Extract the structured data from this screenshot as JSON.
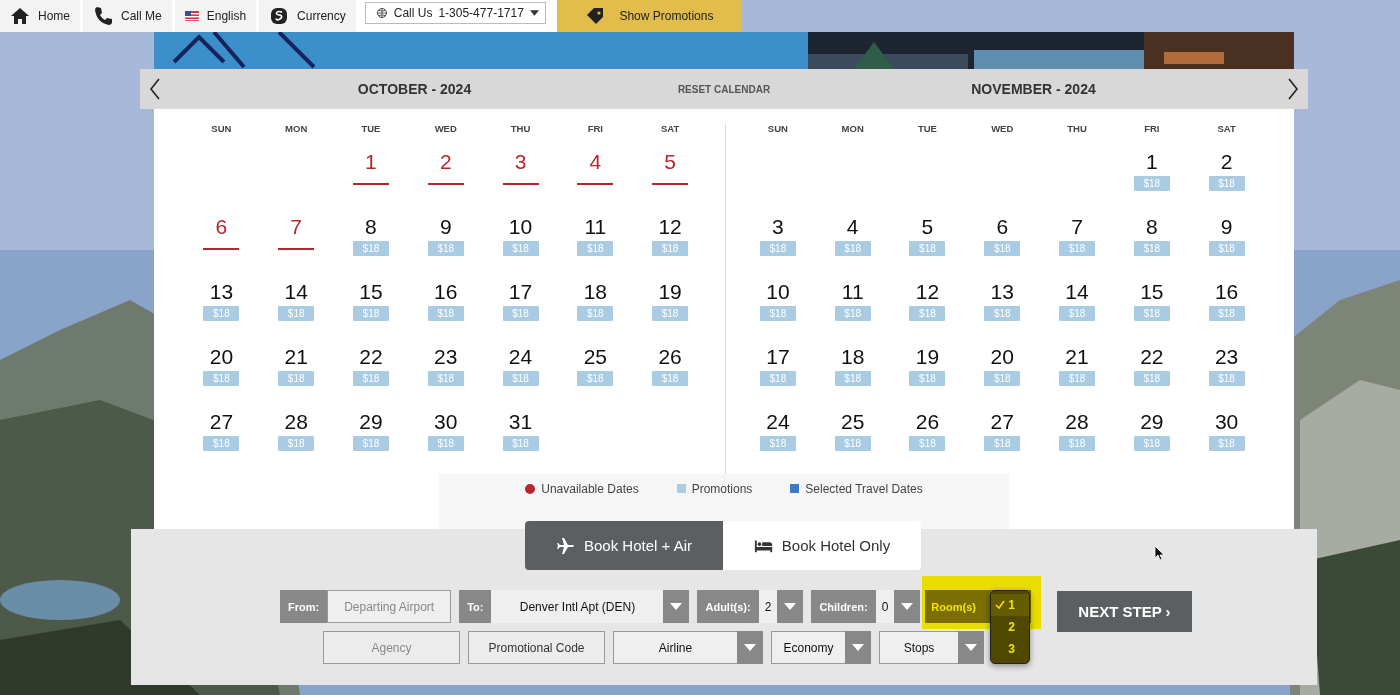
{
  "top_nav": [
    {
      "kind": "link",
      "label": "Home"
    },
    {
      "kind": "link",
      "label": "Call Me"
    },
    {
      "kind": "link",
      "label": "English"
    },
    {
      "kind": "link",
      "label": "Currency"
    },
    {
      "kind": "dropdown",
      "label": "Call Us",
      "number": "1-305-477-1717"
    },
    {
      "kind": "promo",
      "label": "Show Promotions"
    }
  ],
  "calendar": {
    "reset": "RESET CALENDAR",
    "months": [
      {
        "title": "OCTOBER - 2024",
        "weekdays": [
          "SUN",
          "MON",
          "TUE",
          "WED",
          "THU",
          "FRI",
          "SAT"
        ],
        "weeks": [
          [
            {
              "kind": "blank"
            },
            {
              "kind": "blank"
            },
            {
              "kind": "day",
              "day": "1",
              "unavailable": true
            },
            {
              "kind": "day",
              "day": "2",
              "unavailable": true
            },
            {
              "kind": "day",
              "day": "3",
              "unavailable": true
            },
            {
              "kind": "day",
              "day": "4",
              "unavailable": true
            },
            {
              "kind": "day",
              "day": "5",
              "unavailable": true
            }
          ],
          [
            {
              "kind": "day",
              "day": "6",
              "unavailable": true
            },
            {
              "kind": "day",
              "day": "7",
              "unavailable": true
            },
            {
              "kind": "day",
              "day": "8",
              "unavailable": false,
              "price": "$18"
            },
            {
              "kind": "day",
              "day": "9",
              "unavailable": false,
              "price": "$18"
            },
            {
              "kind": "day",
              "day": "10",
              "unavailable": false,
              "price": "$18"
            },
            {
              "kind": "day",
              "day": "11",
              "unavailable": false,
              "price": "$18"
            },
            {
              "kind": "day",
              "day": "12",
              "unavailable": false,
              "price": "$18"
            }
          ],
          [
            {
              "kind": "day",
              "day": "13",
              "unavailable": false,
              "price": "$18"
            },
            {
              "kind": "day",
              "day": "14",
              "unavailable": false,
              "price": "$18"
            },
            {
              "kind": "day",
              "day": "15",
              "unavailable": false,
              "price": "$18"
            },
            {
              "kind": "day",
              "day": "16",
              "unavailable": false,
              "price": "$18"
            },
            {
              "kind": "day",
              "day": "17",
              "unavailable": false,
              "price": "$18"
            },
            {
              "kind": "day",
              "day": "18",
              "unavailable": false,
              "price": "$18"
            },
            {
              "kind": "day",
              "day": "19",
              "unavailable": false,
              "price": "$18"
            }
          ],
          [
            {
              "kind": "day",
              "day": "20",
              "unavailable": false,
              "price": "$18"
            },
            {
              "kind": "day",
              "day": "21",
              "unavailable": false,
              "price": "$18"
            },
            {
              "kind": "day",
              "day": "22",
              "unavailable": false,
              "price": "$18"
            },
            {
              "kind": "day",
              "day": "23",
              "unavailable": false,
              "price": "$18"
            },
            {
              "kind": "day",
              "day": "24",
              "unavailable": false,
              "price": "$18"
            },
            {
              "kind": "day",
              "day": "25",
              "unavailable": false,
              "price": "$18"
            },
            {
              "kind": "day",
              "day": "26",
              "unavailable": false,
              "price": "$18"
            }
          ],
          [
            {
              "kind": "day",
              "day": "27",
              "unavailable": false,
              "price": "$18"
            },
            {
              "kind": "day",
              "day": "28",
              "unavailable": false,
              "price": "$18"
            },
            {
              "kind": "day",
              "day": "29",
              "unavailable": false,
              "price": "$18"
            },
            {
              "kind": "day",
              "day": "30",
              "unavailable": false,
              "price": "$18"
            },
            {
              "kind": "day",
              "day": "31",
              "unavailable": false,
              "price": "$18"
            },
            {
              "kind": "blank"
            },
            {
              "kind": "blank"
            }
          ]
        ]
      },
      {
        "title": "NOVEMBER - 2024",
        "weekdays": [
          "SUN",
          "MON",
          "TUE",
          "WED",
          "THU",
          "FRI",
          "SAT"
        ],
        "weeks": [
          [
            {
              "kind": "blank"
            },
            {
              "kind": "blank"
            },
            {
              "kind": "blank"
            },
            {
              "kind": "blank"
            },
            {
              "kind": "blank"
            },
            {
              "kind": "day",
              "day": "1",
              "unavailable": false,
              "price": "$18"
            },
            {
              "kind": "day",
              "day": "2",
              "unavailable": false,
              "price": "$18"
            }
          ],
          [
            {
              "kind": "day",
              "day": "3",
              "unavailable": false,
              "price": "$18"
            },
            {
              "kind": "day",
              "day": "4",
              "unavailable": false,
              "price": "$18"
            },
            {
              "kind": "day",
              "day": "5",
              "unavailable": false,
              "price": "$18"
            },
            {
              "kind": "day",
              "day": "6",
              "unavailable": false,
              "price": "$18"
            },
            {
              "kind": "day",
              "day": "7",
              "unavailable": false,
              "price": "$18"
            },
            {
              "kind": "day",
              "day": "8",
              "unavailable": false,
              "price": "$18"
            },
            {
              "kind": "day",
              "day": "9",
              "unavailable": false,
              "price": "$18"
            }
          ],
          [
            {
              "kind": "day",
              "day": "10",
              "unavailable": false,
              "price": "$18"
            },
            {
              "kind": "day",
              "day": "11",
              "unavailable": false,
              "price": "$18"
            },
            {
              "kind": "day",
              "day": "12",
              "unavailable": false,
              "price": "$18"
            },
            {
              "kind": "day",
              "day": "13",
              "unavailable": false,
              "price": "$18"
            },
            {
              "kind": "day",
              "day": "14",
              "unavailable": false,
              "price": "$18"
            },
            {
              "kind": "day",
              "day": "15",
              "unavailable": false,
              "price": "$18"
            },
            {
              "kind": "day",
              "day": "16",
              "unavailable": false,
              "price": "$18"
            }
          ],
          [
            {
              "kind": "day",
              "day": "17",
              "unavailable": false,
              "price": "$18"
            },
            {
              "kind": "day",
              "day": "18",
              "unavailable": false,
              "price": "$18"
            },
            {
              "kind": "day",
              "day": "19",
              "unavailable": false,
              "price": "$18"
            },
            {
              "kind": "day",
              "day": "20",
              "unavailable": false,
              "price": "$18"
            },
            {
              "kind": "day",
              "day": "21",
              "unavailable": false,
              "price": "$18"
            },
            {
              "kind": "day",
              "day": "22",
              "unavailable": false,
              "price": "$18"
            },
            {
              "kind": "day",
              "day": "23",
              "unavailable": false,
              "price": "$18"
            }
          ],
          [
            {
              "kind": "day",
              "day": "24",
              "unavailable": false,
              "price": "$18"
            },
            {
              "kind": "day",
              "day": "25",
              "unavailable": false,
              "price": "$18"
            },
            {
              "kind": "day",
              "day": "26",
              "unavailable": false,
              "price": "$18"
            },
            {
              "kind": "day",
              "day": "27",
              "unavailable": false,
              "price": "$18"
            },
            {
              "kind": "day",
              "day": "28",
              "unavailable": false,
              "price": "$18"
            },
            {
              "kind": "day",
              "day": "29",
              "unavailable": false,
              "price": "$18"
            },
            {
              "kind": "day",
              "day": "30",
              "unavailable": false,
              "price": "$18"
            }
          ]
        ]
      }
    ],
    "legend": [
      {
        "kind": "dot",
        "color": "#b5272d",
        "label": "Unavailable Dates"
      },
      {
        "kind": "square",
        "color": "#a9cce3",
        "label": "Promotions"
      },
      {
        "kind": "square",
        "color": "#3f79c4",
        "label": "Selected Travel Dates"
      }
    ]
  },
  "booking": {
    "modes": [
      {
        "label": "Book Hotel + Air",
        "selected": true
      },
      {
        "label": "Book Hotel Only",
        "selected": false
      }
    ],
    "row_1": [
      {
        "kind": "labeled-input",
        "label": "From:",
        "placeholder": "Departing Airport"
      },
      {
        "kind": "labeled-select",
        "label": "To:",
        "value": "Denver Intl Apt (DEN)"
      },
      {
        "kind": "labeled-select",
        "label": "Adult(s):",
        "value": "2"
      },
      {
        "kind": "labeled-select",
        "label": "Children:",
        "value": "0"
      },
      {
        "kind": "rooms",
        "label": "Room(s)",
        "options": [
          {
            "label": "1",
            "selected": true
          },
          {
            "label": "2",
            "selected": false
          },
          {
            "label": "3",
            "selected": false
          }
        ]
      }
    ],
    "row_2": [
      {
        "kind": "input",
        "placeholder": "Agency"
      },
      {
        "kind": "button",
        "label": "Promotional Code"
      },
      {
        "kind": "select",
        "value": "Airline"
      },
      {
        "kind": "select",
        "value": "Economy"
      },
      {
        "kind": "select",
        "value": "Stops"
      }
    ],
    "next_step": "NEXT STEP ›"
  }
}
